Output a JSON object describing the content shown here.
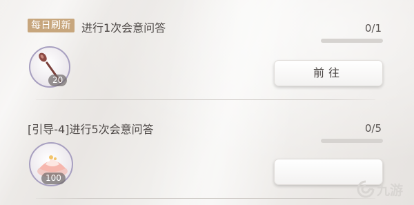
{
  "tasks": [
    {
      "badge": "每日刷新",
      "title": "进行1次会意问答",
      "progress": "0/1",
      "progress_fraction": 0,
      "item_icon": "spoon-icon",
      "item_count": "20",
      "button_label": "前往"
    },
    {
      "title": "[引导-4]进行5次会意问答",
      "progress": "0/5",
      "progress_fraction": 0,
      "item_icon": "dessert-icon",
      "item_count": "100",
      "button_label": ""
    }
  ],
  "watermark": {
    "text": "九游",
    "icon": "jiuyou-logo-icon"
  },
  "colors": {
    "badge": "#c7a67d",
    "icon_ring": "#a79fc0",
    "button_bg": "#ffffff"
  }
}
